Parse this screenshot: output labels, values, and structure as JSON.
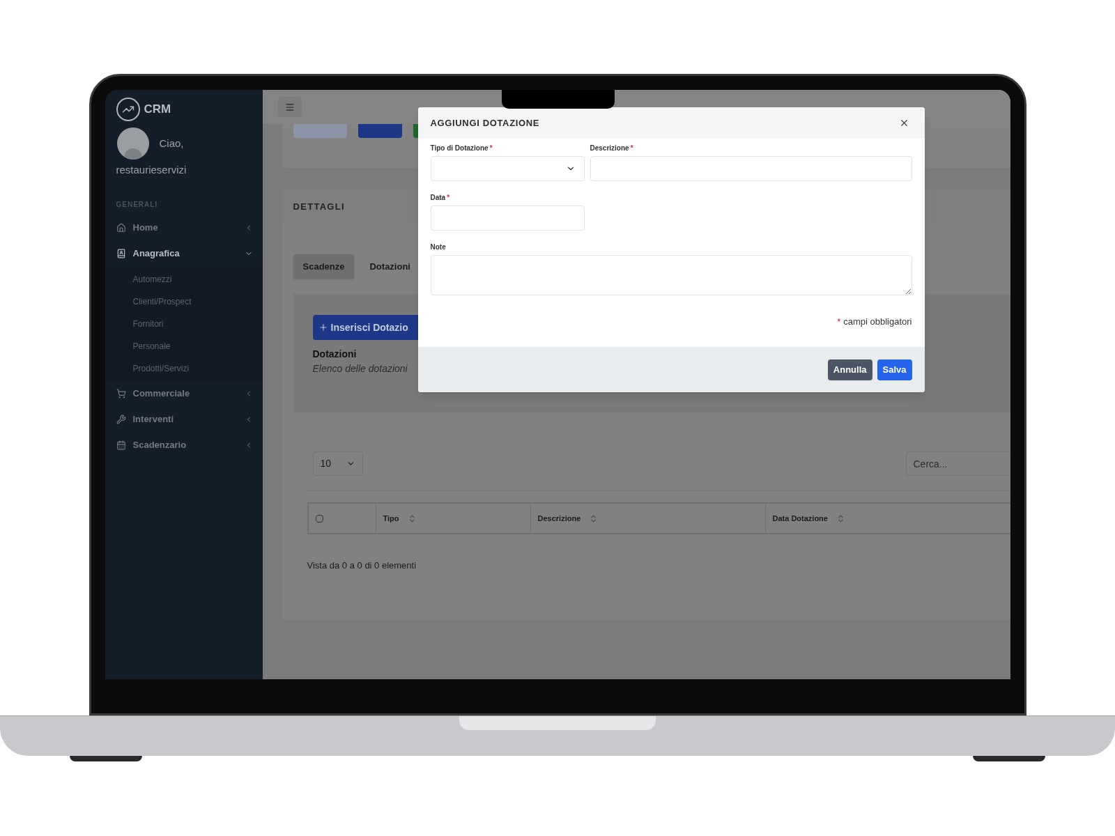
{
  "sidebar": {
    "logo_text": "CRM",
    "greeting": "Ciao,",
    "username": "restaurieservizi",
    "section_label": "GENERALI",
    "items": [
      {
        "label": "Home",
        "expanded": false
      },
      {
        "label": "Anagrafica",
        "expanded": true,
        "children": [
          {
            "label": "Automezzi"
          },
          {
            "label": "Clienti/Prospect"
          },
          {
            "label": "Fornitori"
          },
          {
            "label": "Personale"
          },
          {
            "label": "Prodotti/Servizi"
          }
        ]
      },
      {
        "label": "Commerciale",
        "expanded": false
      },
      {
        "label": "Interventi",
        "expanded": false
      },
      {
        "label": "Scadenzario",
        "expanded": false
      }
    ]
  },
  "details": {
    "title": "DETTAGLI",
    "tabs": [
      {
        "label": "Scadenze",
        "selected": true
      },
      {
        "label": "Dotazioni",
        "selected": false
      }
    ],
    "add_button": "Inserisci Dotazio",
    "section_title": "Dotazioni",
    "section_subtitle": "Elenco delle dotazioni",
    "page_size": "10",
    "search": {
      "placeholder": "Cerca..."
    },
    "table": {
      "select_all_checked": false,
      "columns": [
        "Tipo",
        "Descrizione",
        "Data Dotazione"
      ]
    },
    "info": "Vista da 0 a 0 di 0 elementi"
  },
  "modal": {
    "title": "AGGIUNGI DOTAZIONE",
    "fields": [
      {
        "label": "Tipo di Dotazione",
        "mark": "*",
        "kind": "select"
      },
      {
        "label": "Descrizione",
        "mark": "*",
        "kind": "text"
      },
      {
        "label": "Data",
        "mark": "*",
        "kind": "text"
      },
      {
        "label": "Note",
        "kind": "textarea"
      }
    ],
    "required_note": {
      "mark": "*",
      "text": "campi obbligatori"
    },
    "buttons": [
      {
        "label": "Annulla",
        "kind": "secondary"
      },
      {
        "label": "Salva",
        "kind": "primary"
      }
    ]
  }
}
